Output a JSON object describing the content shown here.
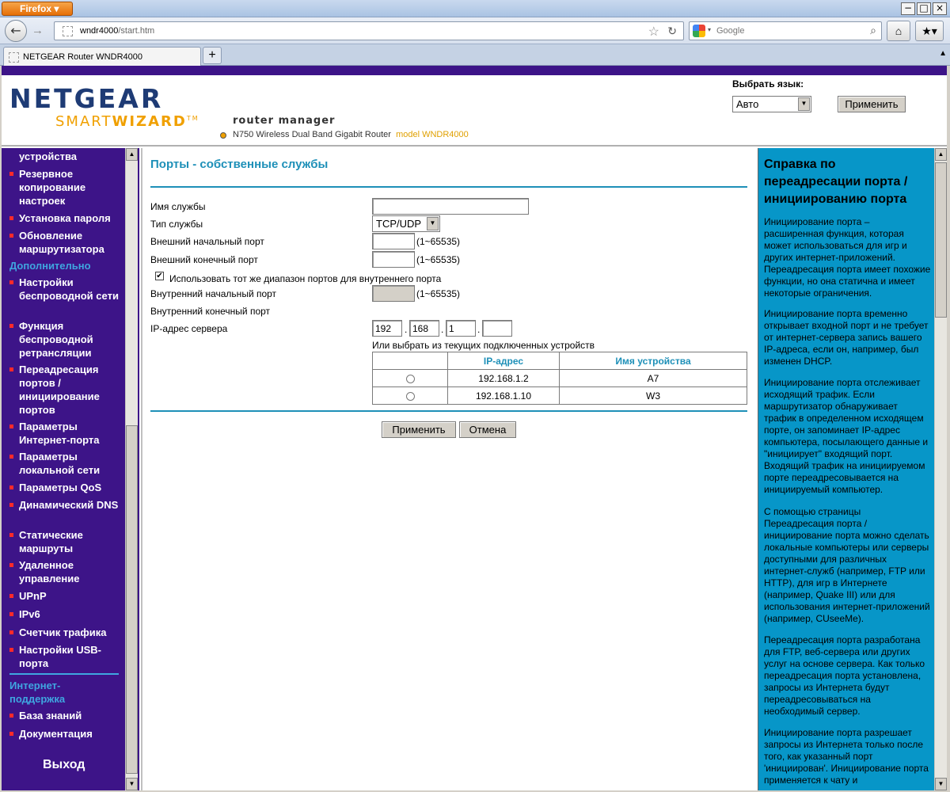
{
  "browser": {
    "menu_label": "Firefox",
    "url": "wndr4000",
    "url_rest": "/start.htm",
    "search_placeholder": "Google",
    "tab_title": "NETGEAR Router WNDR4000",
    "new_tab": "+"
  },
  "header": {
    "logo_top": "NETGEAR",
    "logo_smart": "SMART",
    "logo_wizard": "WIZARD",
    "logo_tm": "TM",
    "subtitle": "router manager",
    "model_text": "N750 Wireless Dual Band Gigabit Router",
    "model_name": "model WNDR4000",
    "lang_label": "Выбрать язык:",
    "lang_value": "Авто",
    "lang_apply": "Применить"
  },
  "sidebar": {
    "items": [
      {
        "label": "устройства",
        "bullet": false
      },
      {
        "label": "Резервное копирование настроек",
        "bullet": true
      },
      {
        "label": "Установка пароля",
        "bullet": true
      },
      {
        "label": "Обновление маршрутизатора",
        "bullet": true
      }
    ],
    "section_advanced": "Дополнительно",
    "advanced_items": [
      "Настройки беспроводной сети",
      "Функция беспроводной ретрансляции",
      "Переадресация портов / инициирование портов",
      "Параметры Интернет-порта",
      "Параметры локальной сети",
      "Параметры QoS",
      "Динамический DNS",
      "Статические маршруты",
      "Удаленное управление",
      "UPnP",
      "IPv6",
      "Счетчик трафика",
      "Настройки USB-порта"
    ],
    "section_support": "Интернет-поддержка",
    "support_items": [
      "База знаний",
      "Документация"
    ],
    "logout": "Выход"
  },
  "form": {
    "title": "Порты - собственные службы",
    "service_name_label": "Имя службы",
    "service_name_value": "",
    "service_type_label": "Тип службы",
    "service_type_value": "TCP/UDP",
    "ext_start_label": "Внешний начальный порт",
    "ext_start_value": "",
    "ext_end_label": "Внешний конечный порт",
    "ext_end_value": "",
    "range_hint": "(1~65535)",
    "same_range_label": "Использовать тот же диапазон портов для внутреннего порта",
    "same_range_checked": true,
    "int_start_label": "Внутренний начальный порт",
    "int_end_label": "Внутренний конечный порт",
    "ip_label": "IP-адрес сервера",
    "ip": [
      "192",
      "168",
      "1",
      ""
    ],
    "ip_dot": ".",
    "choose_label": "Или выбрать из текущих подключенных устройств",
    "table_headers": [
      "",
      "IP-адрес",
      "Имя устройства"
    ],
    "devices": [
      {
        "ip": "192.168.1.2",
        "name": "A7"
      },
      {
        "ip": "192.168.1.10",
        "name": "W3"
      }
    ],
    "apply": "Применить",
    "cancel": "Отмена"
  },
  "help": {
    "title": "Справка по переадресации порта / инициированию порта",
    "paragraphs": [
      "Инициирование порта – расширенная функция, которая может использоваться для игр и других интернет-приложений. Переадресация порта имеет похожие функции, но она статична и имеет некоторые ограничения.",
      "Инициирование порта временно открывает входной порт и не требует от интернет-сервера запись вашего IP-адреса, если он, например, был изменен DHCP.",
      "Инициирование порта отслеживает исходящий трафик. Если маршрутизатор обнаруживает трафик в определенном исходящем порте, он запоминает IP-адрес компьютера, посылающего данные и \"инициирует\" входящий порт. Входящий трафик на инициируемом порте переадресовывается на инициируемый компьютер.",
      "С помощью страницы Переадресация порта / инициирование порта можно сделать локальные компьютеры или серверы доступными для различных интернет-служб (например, FTP или HTTP), для игр в Интернете (например, Quake III) или для использования интернет-приложений (например, CUseeMe).",
      "Переадресация порта разработана для FTP, веб-сервера или других услуг на основе сервера. Как только переадресация порта установлена, запросы из Интернета будут переадресовываться на необходимый сервер.",
      "Инициирование порта разрешает запросы из Интернета только после того, как указанный порт 'инициирован'. Инициирование порта применяется к чату и"
    ]
  }
}
